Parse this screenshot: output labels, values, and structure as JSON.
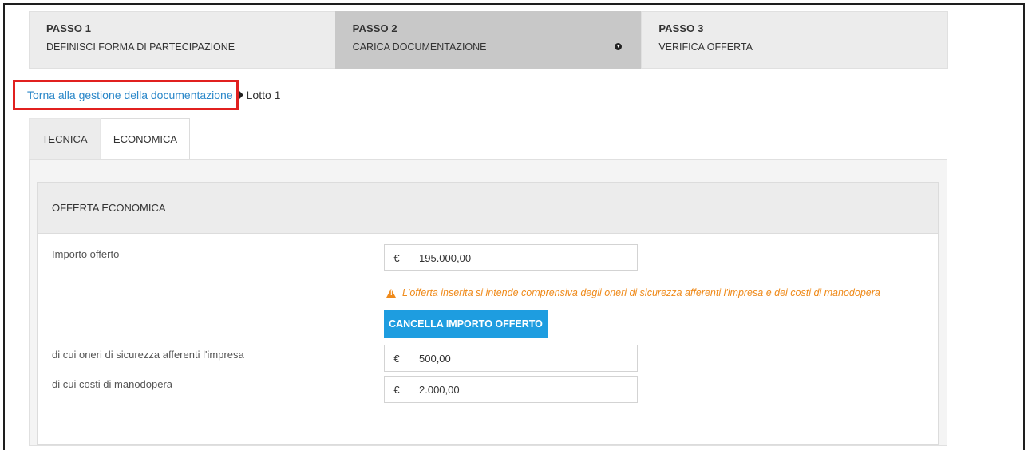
{
  "steps": [
    {
      "num": "PASSO 1",
      "title": "DEFINISCI FORMA DI PARTECIPAZIONE"
    },
    {
      "num": "PASSO 2",
      "title": "CARICA DOCUMENTAZIONE"
    },
    {
      "num": "PASSO 3",
      "title": "VERIFICA OFFERTA"
    }
  ],
  "active_step": 2,
  "breadcrumb": {
    "link": "Torna alla gestione della documentazione",
    "current": "Lotto 1"
  },
  "tabs": [
    {
      "label": "TECNICA"
    },
    {
      "label": "ECONOMICA"
    }
  ],
  "active_tab": "ECONOMICA",
  "offer": {
    "section_title": "OFFERTA ECONOMICA",
    "currency": "€",
    "importo_label": "Importo offerto",
    "importo_value": "195.000,00",
    "warning": "L'offerta inserita si intende comprensiva degli oneri di sicurezza afferenti l'impresa e dei costi di manodopera",
    "cancel_button": "CANCELLA IMPORTO OFFERTO",
    "oneri_label": "di cui oneri di sicurezza afferenti l'impresa",
    "oneri_value": "500,00",
    "costi_label": "di cui costi di manodopera",
    "costi_value": "2.000,00"
  },
  "colors": {
    "accent": "#1e9de0",
    "link": "#2a87c9",
    "warning": "#ef8a1a",
    "highlight": "#e1201f"
  }
}
